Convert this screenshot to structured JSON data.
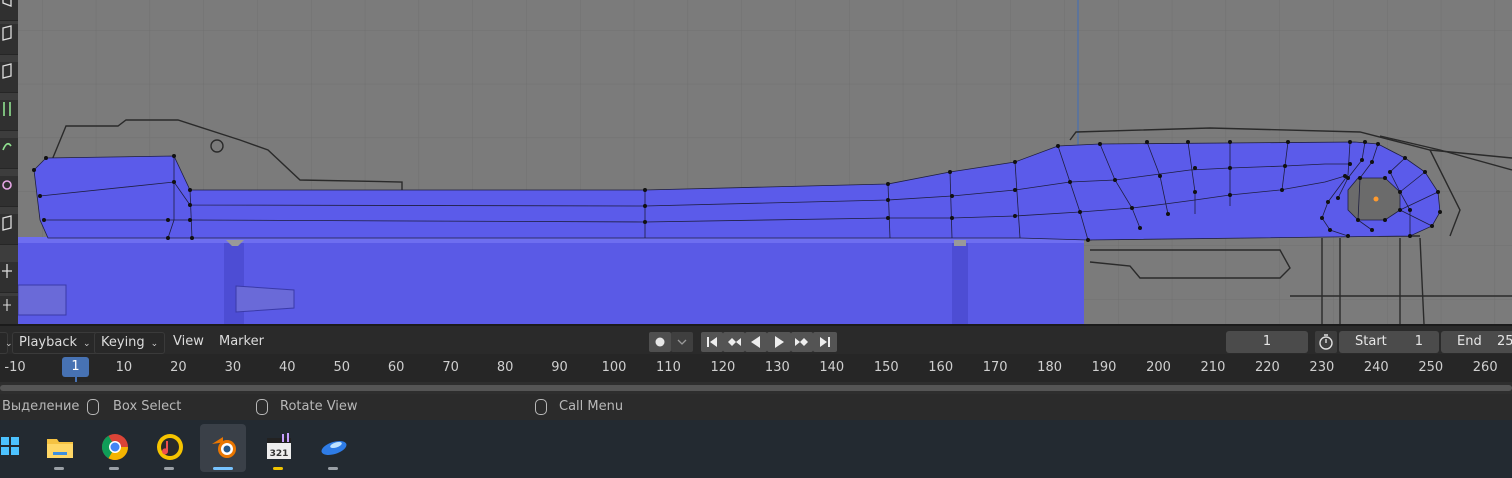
{
  "timeline": {
    "menus": {
      "playback": "Playback",
      "keying": "Keying",
      "view": "View",
      "marker": "Marker"
    },
    "current_frame": "1",
    "start_label": "Start",
    "start_value": "1",
    "end_label": "End",
    "end_value": "25",
    "ruler_ticks": [
      "-10",
      "10",
      "20",
      "30",
      "40",
      "50",
      "60",
      "70",
      "80",
      "90",
      "100",
      "110",
      "120",
      "130",
      "140",
      "150",
      "160",
      "170",
      "180",
      "190",
      "200",
      "210",
      "220",
      "230",
      "240",
      "250",
      "260"
    ],
    "playhead_label": "1"
  },
  "status_bar": {
    "select": "Выделение",
    "box_select": "Box Select",
    "rotate_view": "Rotate View",
    "call_menu": "Call Menu"
  },
  "taskbar": {
    "apps": [
      "windows-start-icon",
      "file-explorer-icon",
      "chrome-icon",
      "music-player-icon",
      "blender-icon",
      "media-player-icon",
      "app-icon"
    ]
  },
  "colors": {
    "mesh_fill": "#5b5bea",
    "accent": "#4772b3",
    "viewport_bg": "#7b7b7b"
  }
}
